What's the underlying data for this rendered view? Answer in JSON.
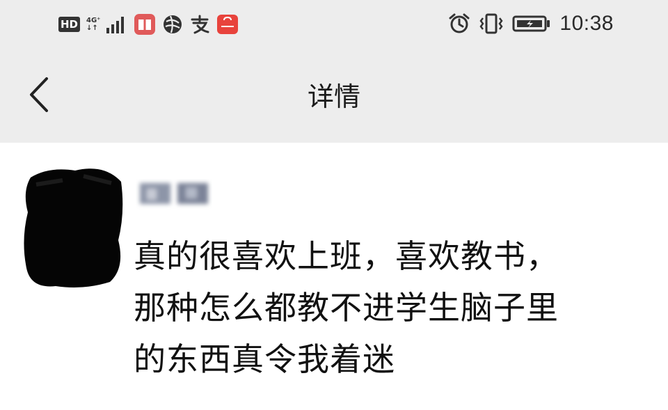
{
  "status_bar": {
    "hd_label": "HD",
    "network_top": "4G⁺",
    "network_bottom": "↓↑",
    "time": "10:38"
  },
  "header": {
    "title": "详情"
  },
  "post": {
    "lines": [
      "真的很喜欢上班，喜欢教书，",
      "那种怎么都教不进学生脑子里",
      "的东西真令我着迷"
    ]
  },
  "colors": {
    "bar_background": "#ededed",
    "content_background": "#ffffff",
    "text": "#111111"
  }
}
